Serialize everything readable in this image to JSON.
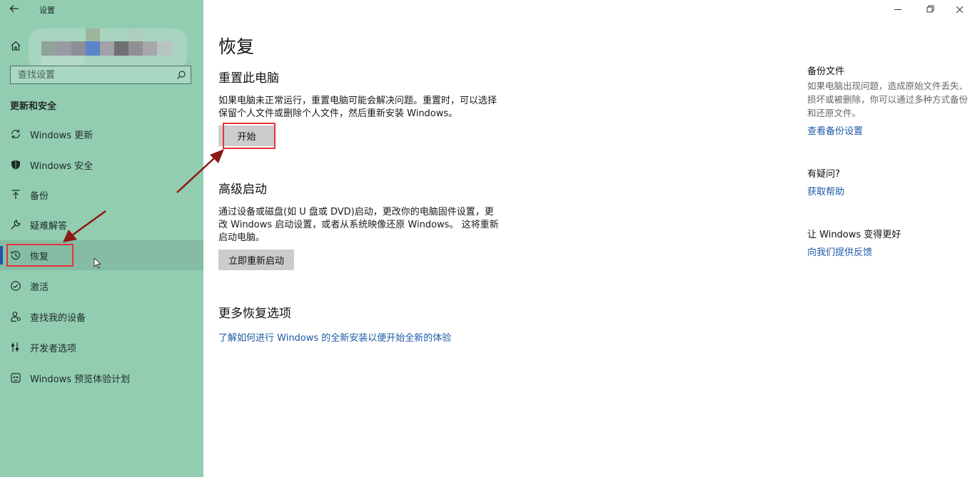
{
  "window": {
    "title": "设置",
    "controls": {
      "minimize": "minimize-icon",
      "maximize": "restore-icon",
      "close": "close-icon"
    }
  },
  "sidebar": {
    "home_label": "主",
    "search_placeholder": "查找设置",
    "section_title": "更新和安全",
    "items": [
      {
        "label": "Windows 更新",
        "icon": "sync-icon"
      },
      {
        "label": "Windows 安全",
        "icon": "shield-icon"
      },
      {
        "label": "备份",
        "icon": "backup-arrow-icon"
      },
      {
        "label": "疑难解答",
        "icon": "wrench-icon"
      },
      {
        "label": "恢复",
        "icon": "history-icon"
      },
      {
        "label": "激活",
        "icon": "check-circle-icon"
      },
      {
        "label": "查找我的设备",
        "icon": "person-location-icon"
      },
      {
        "label": "开发者选项",
        "icon": "developer-icon"
      },
      {
        "label": "Windows 预览体验计划",
        "icon": "insider-icon"
      }
    ],
    "active_index": 4
  },
  "main": {
    "title": "恢复",
    "reset": {
      "heading": "重置此电脑",
      "description": "如果电脑未正常运行，重置电脑可能会解决问题。重置时，可以选择保留个人文件或删除个人文件，然后重新安装 Windows。",
      "button": "开始"
    },
    "advanced": {
      "heading": "高级启动",
      "description": "通过设备或磁盘(如 U 盘或 DVD)启动，更改你的电脑固件设置，更改 Windows 启动设置，或者从系统映像还原 Windows。 这将重新启动电脑。",
      "button": "立即重新启动"
    },
    "more": {
      "heading": "更多恢复选项",
      "link": "了解如何进行 Windows 的全新安装以便开始全新的体验"
    }
  },
  "aside": {
    "backup": {
      "heading": "备份文件",
      "description": "如果电脑出现问题，造成原始文件丢失、损坏或被删除，你可以通过多种方式备份和还原文件。",
      "link": "查看备份设置"
    },
    "question": {
      "heading": "有疑问?",
      "link": "获取帮助"
    },
    "feedback": {
      "heading": "让 Windows 变得更好",
      "link": "向我们提供反馈"
    }
  },
  "colors": {
    "sidebar_bg": "#92cdb1",
    "link": "#1f5aa6",
    "annotation_red": "#e8323c",
    "annotation_arrow": "#8b1a12"
  }
}
